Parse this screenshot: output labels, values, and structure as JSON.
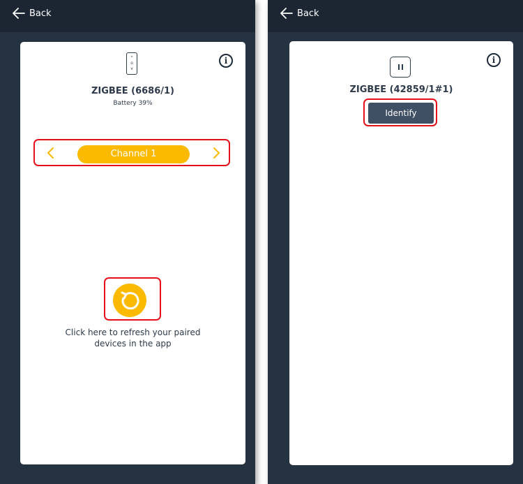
{
  "left_screen": {
    "back_label": "Back",
    "device_name": "ZIGBEE (6686/1)",
    "battery": "Battery 39%",
    "channel_label": "Channel 1",
    "refresh_hint": "Click here to refresh your paired devices in the app",
    "icons": {
      "back": "arrow-left-icon",
      "device": "remote-control-icon",
      "info": "info-icon",
      "prev": "chevron-left-icon",
      "next": "chevron-right-icon",
      "refresh": "refresh-icon"
    }
  },
  "right_screen": {
    "back_label": "Back",
    "device_name": "ZIGBEE (42859/1#1)",
    "identify_label": "Identify",
    "icons": {
      "back": "arrow-left-icon",
      "device": "pause-switch-icon",
      "info": "info-icon"
    }
  },
  "colors": {
    "background_dark": "#253241",
    "topbar": "#1c2633",
    "accent": "#fbb900",
    "button": "#3f4f64",
    "highlight": "#e3101b"
  }
}
